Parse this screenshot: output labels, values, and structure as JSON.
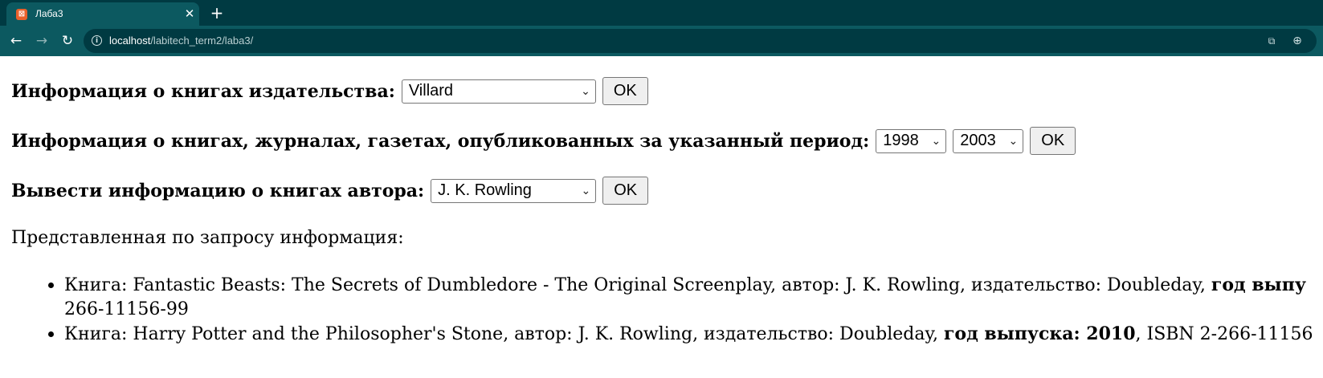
{
  "browser": {
    "tab_title": "Лаба3",
    "favicon": "xampp-icon",
    "url_host": "localhost",
    "url_path": "/labitech_term2/laba3/",
    "accent_color": "#0c5960"
  },
  "forms": {
    "publisher": {
      "label": "Информация о книгах издательства:",
      "selected": "Villard",
      "button": "OK"
    },
    "period": {
      "label": "Информация о книгах, журналах, газетах, опубликованных за указанный период:",
      "from_year": "1998",
      "to_year": "2003",
      "button": "OK"
    },
    "author": {
      "label": "Вывести информацию о книгах автора:",
      "selected": "J. K. Rowling",
      "button": "OK"
    }
  },
  "results": {
    "heading": "Представленная по запросу информация:",
    "items": [
      {
        "line1_text": "Книга: Fantastic Beasts: The Secrets of Dumbledore - The Original Screenplay, автор: J. K. Rowling, издательство: Doubleday, ",
        "line1_bold": "год выпу",
        "line2_text": "266-11156-99"
      },
      {
        "text": "Книга: Harry Potter and the Philosopher's Stone, автор: J. K. Rowling, издательство: Doubleday, ",
        "bold": "год выпуска: 2010",
        "tail": ", ISBN 2-266-11156"
      }
    ]
  }
}
